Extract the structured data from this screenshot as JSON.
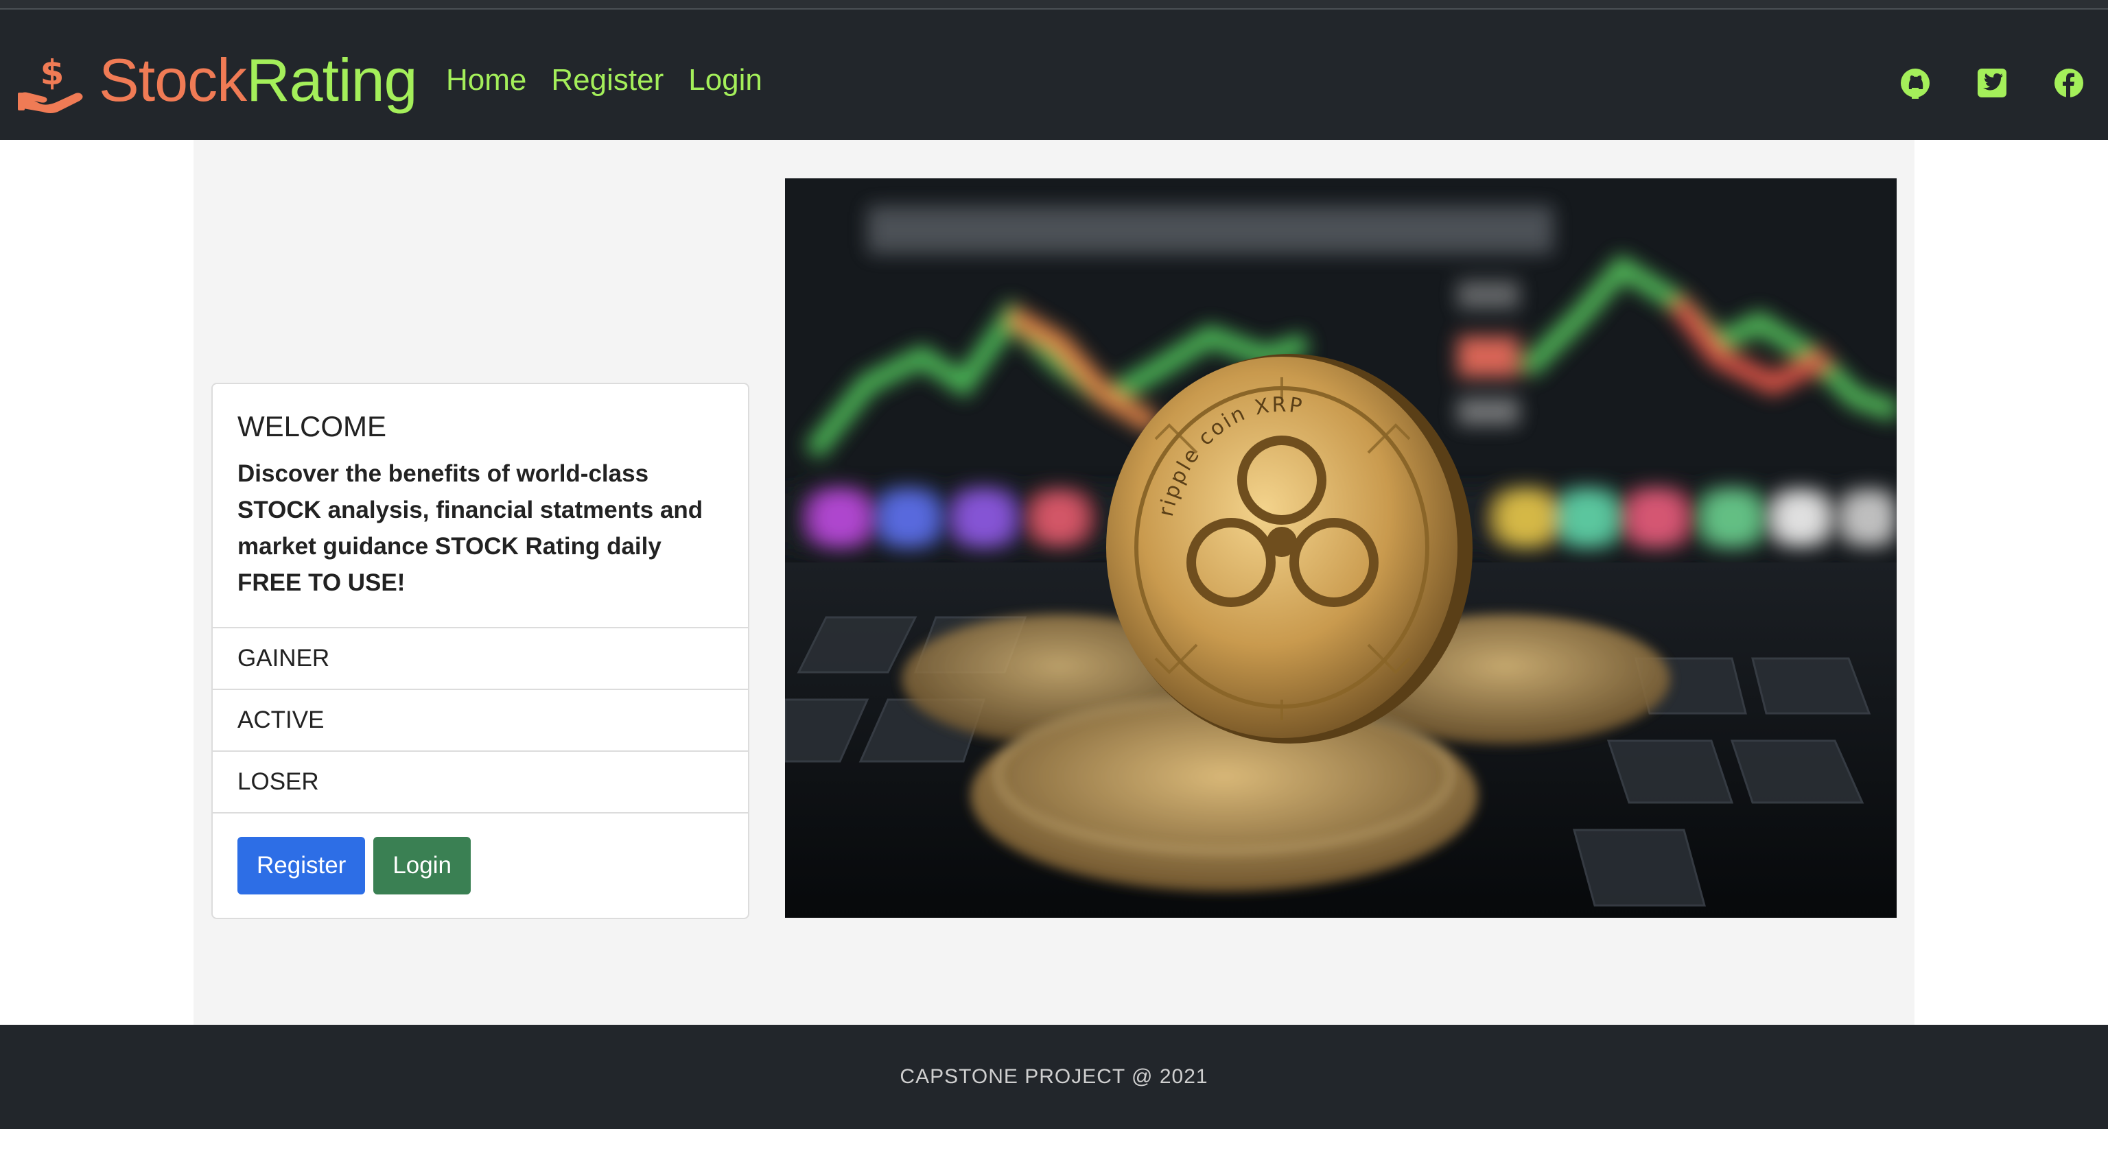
{
  "brand": {
    "part1": "Stock",
    "part2": "Rating",
    "icon": "hand-dollar-icon"
  },
  "nav": {
    "items": [
      {
        "label": "Home"
      },
      {
        "label": "Register"
      },
      {
        "label": "Login"
      }
    ]
  },
  "social": {
    "items": [
      {
        "icon": "github-icon"
      },
      {
        "icon": "twitter-icon"
      },
      {
        "icon": "facebook-icon"
      }
    ]
  },
  "colors": {
    "accent_green": "#a4ef5a",
    "accent_orange": "#f07b55",
    "navbar_bg": "#22262b",
    "primary": "#2d6ee6",
    "success": "#3a8053"
  },
  "card": {
    "title": "WELCOME",
    "text": "Discover the benefits of world-class STOCK analysis, financial statments and market guidance STOCK Rating daily FREE TO USE!",
    "list": [
      {
        "label": "GAINER"
      },
      {
        "label": "ACTIVE"
      },
      {
        "label": "LOSER"
      }
    ],
    "register_button": "Register",
    "login_button": "Login"
  },
  "hero": {
    "coin_text": "ripple coin XRP"
  },
  "footer": {
    "text": "CAPSTONE PROJECT @ 2021"
  }
}
